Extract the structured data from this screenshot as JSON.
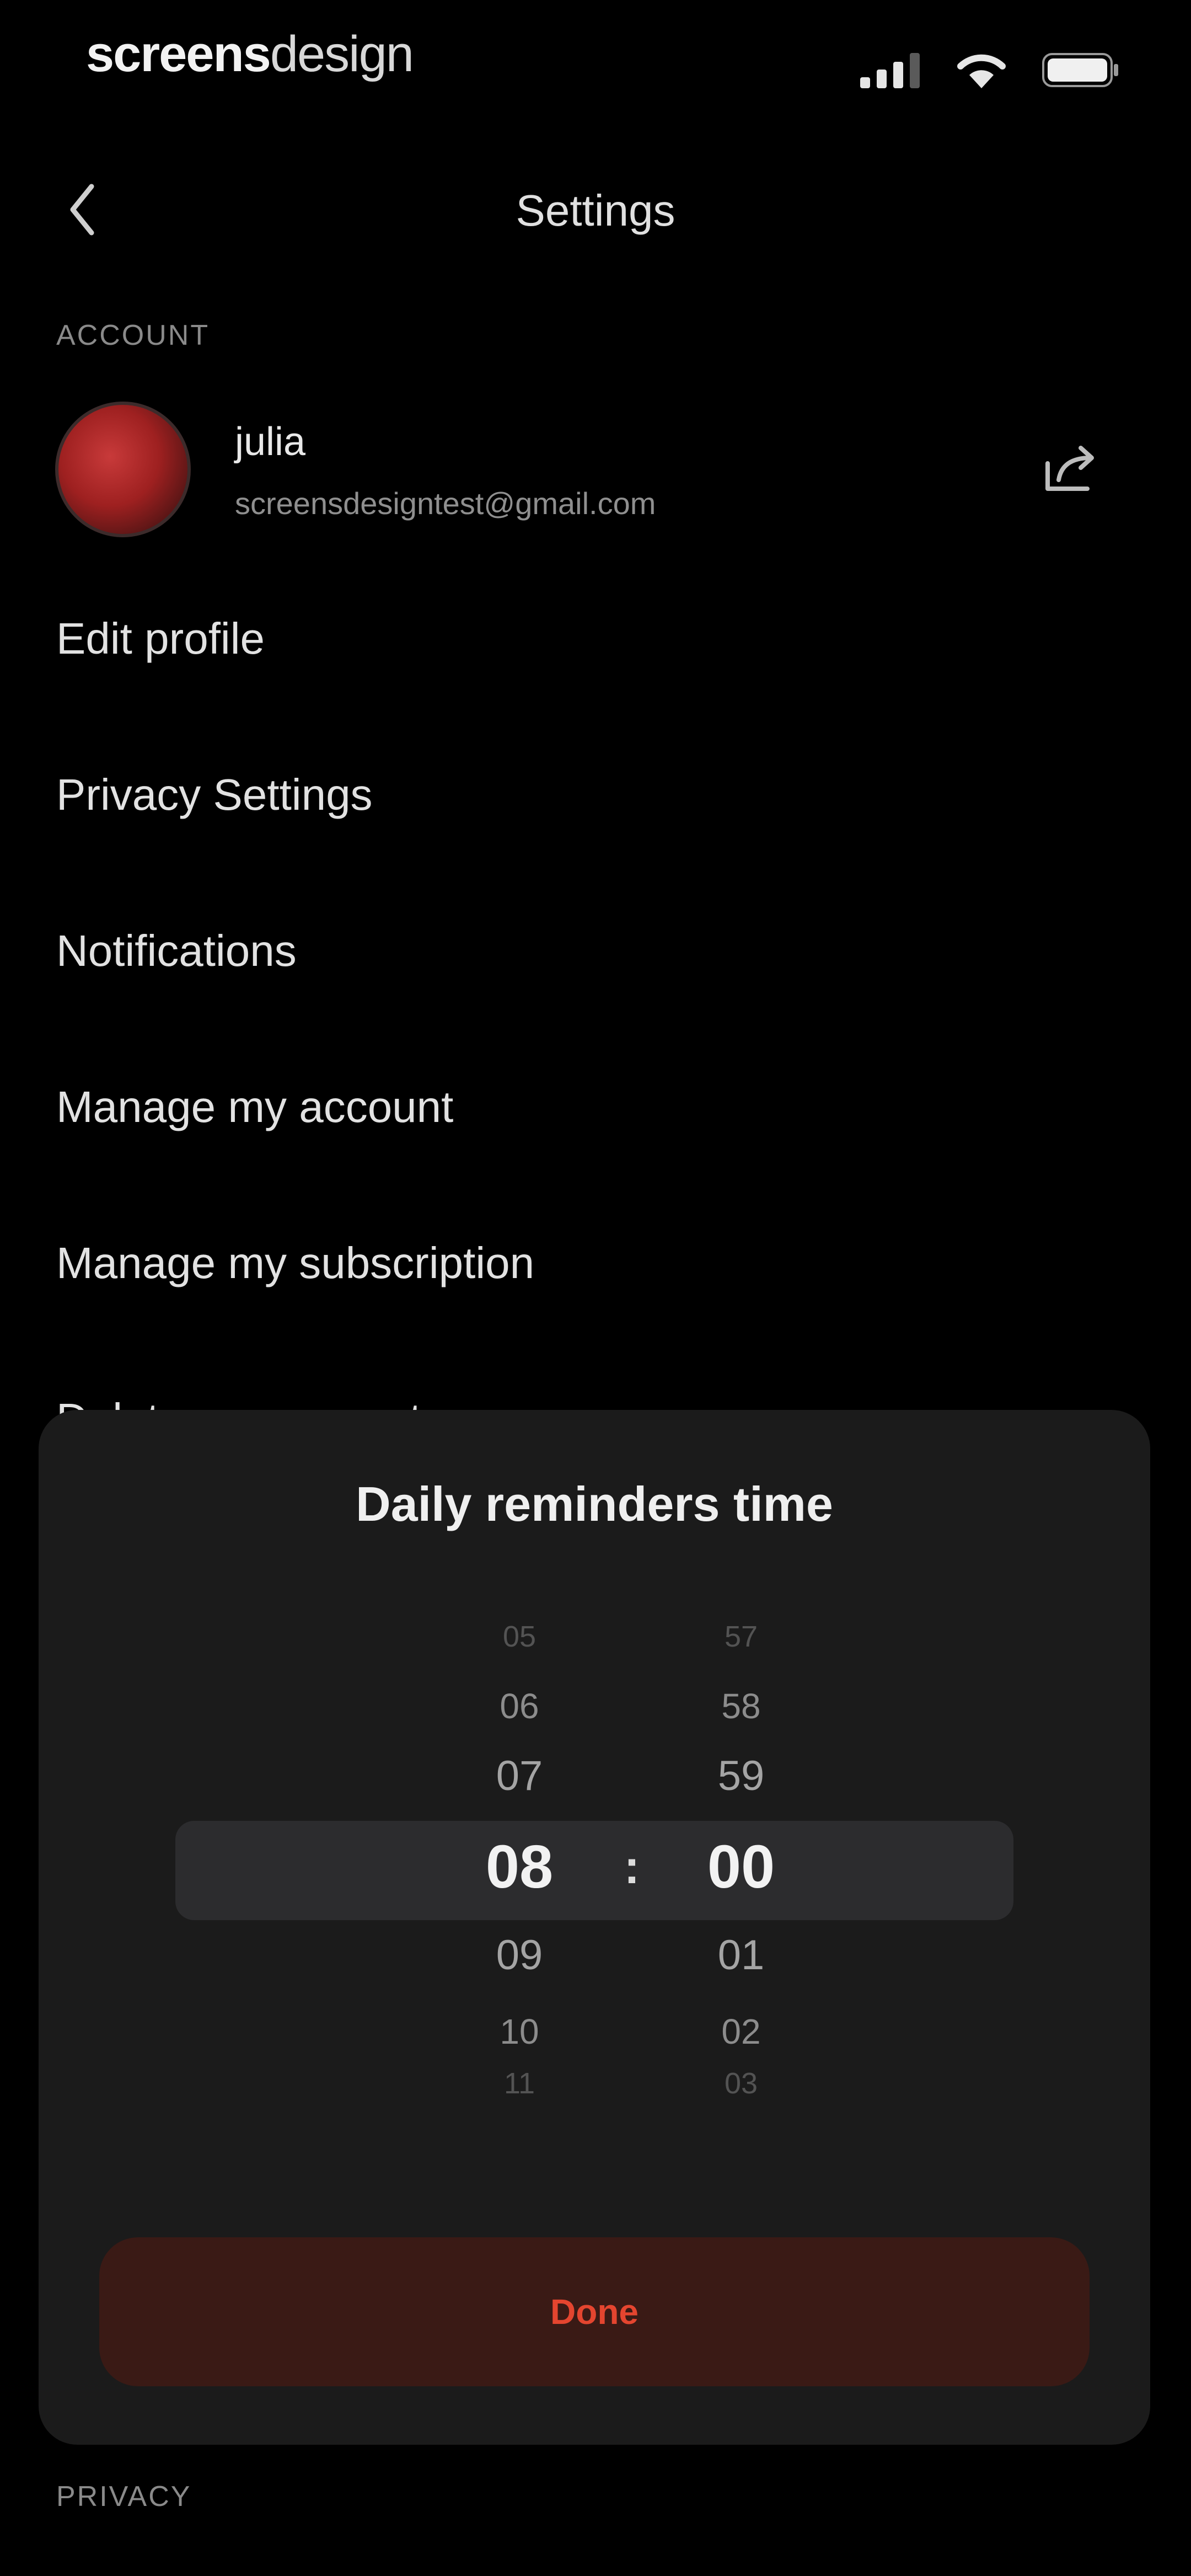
{
  "status_bar": {
    "brand_bold": "screens",
    "brand_light": "design"
  },
  "header": {
    "title": "Settings",
    "back_icon": "chevron-left-icon"
  },
  "sections": {
    "account_label": "ACCOUNT",
    "privacy_label": "PRIVACY"
  },
  "account": {
    "name": "julia",
    "email": "screensdesigntest@gmail.com",
    "share_icon": "share-icon"
  },
  "menu": [
    {
      "label": "Edit profile"
    },
    {
      "label": "Privacy Settings"
    },
    {
      "label": "Notifications"
    },
    {
      "label": "Manage my account"
    },
    {
      "label": "Manage my subscription"
    },
    {
      "label": "Delete my account"
    }
  ],
  "sheet": {
    "title": "Daily reminders time",
    "hours": [
      "05",
      "06",
      "07",
      "08",
      "09",
      "10",
      "11"
    ],
    "minutes": [
      "57",
      "58",
      "59",
      "00",
      "01",
      "02",
      "03"
    ],
    "separator": ":",
    "selected_hour": "08",
    "selected_minute": "00",
    "done_label": "Done"
  },
  "colors": {
    "background": "#000000",
    "sheet": "#1b1b1b",
    "accent": "#e4452f",
    "button_bg": "#3a1a15"
  }
}
